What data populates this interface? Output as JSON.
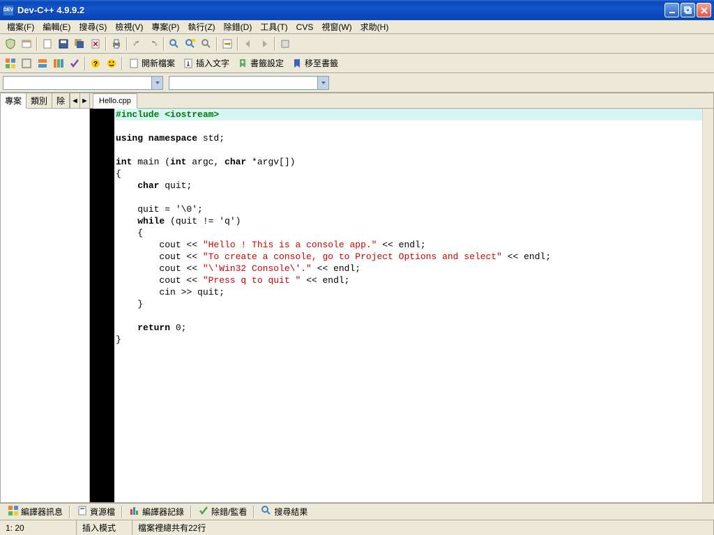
{
  "window": {
    "title": "Dev-C++ 4.9.9.2"
  },
  "menu": [
    {
      "label": "檔案(F)"
    },
    {
      "label": "編輯(E)"
    },
    {
      "label": "搜尋(S)"
    },
    {
      "label": "檢視(V)"
    },
    {
      "label": "專案(P)"
    },
    {
      "label": "執行(Z)"
    },
    {
      "label": "除錯(D)"
    },
    {
      "label": "工具(T)"
    },
    {
      "label": "CVS"
    },
    {
      "label": "視窗(W)"
    },
    {
      "label": "求助(H)"
    }
  ],
  "toolbar2": {
    "btn_open": "開新檔案",
    "btn_insert": "插入文字",
    "btn_bookmark_set": "書籤設定",
    "btn_bookmark_go": "移至書籤"
  },
  "sidebar": {
    "tabs": [
      {
        "label": "專案"
      },
      {
        "label": "類別"
      },
      {
        "label": "除"
      }
    ]
  },
  "editor": {
    "tabs": [
      {
        "label": "Hello.cpp"
      }
    ],
    "code_lines": [
      {
        "hl": true,
        "segs": [
          {
            "c": "pp",
            "t": "#include <iostream>"
          }
        ]
      },
      {
        "segs": []
      },
      {
        "segs": [
          {
            "c": "kw",
            "t": "using namespace"
          },
          {
            "c": "norm",
            "t": " std;"
          }
        ]
      },
      {
        "segs": []
      },
      {
        "segs": [
          {
            "c": "kw",
            "t": "int"
          },
          {
            "c": "norm",
            "t": " main ("
          },
          {
            "c": "kw",
            "t": "int"
          },
          {
            "c": "norm",
            "t": " argc, "
          },
          {
            "c": "kw",
            "t": "char"
          },
          {
            "c": "norm",
            "t": " *argv[])"
          }
        ]
      },
      {
        "segs": [
          {
            "c": "norm",
            "t": "{"
          }
        ]
      },
      {
        "segs": [
          {
            "c": "norm",
            "t": "    "
          },
          {
            "c": "kw",
            "t": "char"
          },
          {
            "c": "norm",
            "t": " quit;"
          }
        ]
      },
      {
        "segs": []
      },
      {
        "segs": [
          {
            "c": "norm",
            "t": "    quit = '\\0';"
          }
        ]
      },
      {
        "segs": [
          {
            "c": "norm",
            "t": "    "
          },
          {
            "c": "kw",
            "t": "while"
          },
          {
            "c": "norm",
            "t": " (quit != 'q')"
          }
        ]
      },
      {
        "segs": [
          {
            "c": "norm",
            "t": "    {"
          }
        ]
      },
      {
        "segs": [
          {
            "c": "norm",
            "t": "        cout << "
          },
          {
            "c": "str",
            "t": "\"Hello ! This is a console app.\""
          },
          {
            "c": "norm",
            "t": " << endl;"
          }
        ]
      },
      {
        "segs": [
          {
            "c": "norm",
            "t": "        cout << "
          },
          {
            "c": "str",
            "t": "\"To create a console, go to Project Options and select\""
          },
          {
            "c": "norm",
            "t": " << endl;"
          }
        ]
      },
      {
        "segs": [
          {
            "c": "norm",
            "t": "        cout << "
          },
          {
            "c": "str",
            "t": "\"\\'Win32 Console\\'.\""
          },
          {
            "c": "norm",
            "t": " << endl;"
          }
        ]
      },
      {
        "segs": [
          {
            "c": "norm",
            "t": "        cout << "
          },
          {
            "c": "str",
            "t": "\"Press q to quit \""
          },
          {
            "c": "norm",
            "t": " << endl;"
          }
        ]
      },
      {
        "segs": [
          {
            "c": "norm",
            "t": "        cin >> quit;"
          }
        ]
      },
      {
        "segs": [
          {
            "c": "norm",
            "t": "    }"
          }
        ]
      },
      {
        "segs": []
      },
      {
        "segs": [
          {
            "c": "norm",
            "t": "    "
          },
          {
            "c": "kw",
            "t": "return"
          },
          {
            "c": "norm",
            "t": " 0;"
          }
        ]
      },
      {
        "segs": [
          {
            "c": "norm",
            "t": "}"
          }
        ]
      }
    ]
  },
  "bottom_tabs": [
    {
      "label": "編譯器訊息"
    },
    {
      "label": "資源檔"
    },
    {
      "label": "編譯器記錄"
    },
    {
      "label": "除錯/監看"
    },
    {
      "label": "搜尋結果"
    }
  ],
  "status": {
    "pos": "1: 20",
    "mode": "插入模式",
    "lines": "檔案裡總共有22行"
  }
}
